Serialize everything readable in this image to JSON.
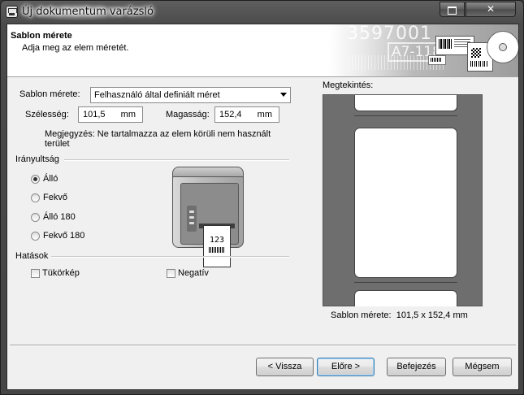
{
  "window": {
    "title": "Új dokumentum varázsló",
    "maximize_icon": "maximize-icon",
    "close_glyph": "✕"
  },
  "header": {
    "title": "Sablon mérete",
    "subtitle": "Adja meg az elem méretét.",
    "art_number1": "3597001",
    "art_number2": "A7-118"
  },
  "size": {
    "template_label": "Sablon mérete:",
    "template_value": "Felhasználó által definiált méret",
    "width_label": "Szélesség:",
    "width_value": "101,5",
    "width_unit": "mm",
    "height_label": "Magasság:",
    "height_value": "152,4",
    "height_unit": "mm",
    "note": "Megjegyzés: Ne tartalmazza az elem körüli nem használt terület"
  },
  "orientation": {
    "group_label": "Irányultság",
    "options": [
      {
        "label": "Álló",
        "checked": true
      },
      {
        "label": "Fekvő",
        "checked": false
      },
      {
        "label": "Álló 180",
        "checked": false
      },
      {
        "label": "Fekvő 180",
        "checked": false
      }
    ]
  },
  "printer_illustration": {
    "label_number": "123"
  },
  "effects": {
    "group_label": "Hatások",
    "mirror_label": "Tükörkép",
    "negative_label": "Negatív"
  },
  "preview": {
    "label": "Megtekintés:",
    "size_caption_label": "Sablon mérete:",
    "size_caption_value": "101,5 x 152,4 mm"
  },
  "buttons": {
    "back": "< Vissza",
    "next": "Előre >",
    "finish": "Befejezés",
    "cancel": "Mégsem"
  }
}
